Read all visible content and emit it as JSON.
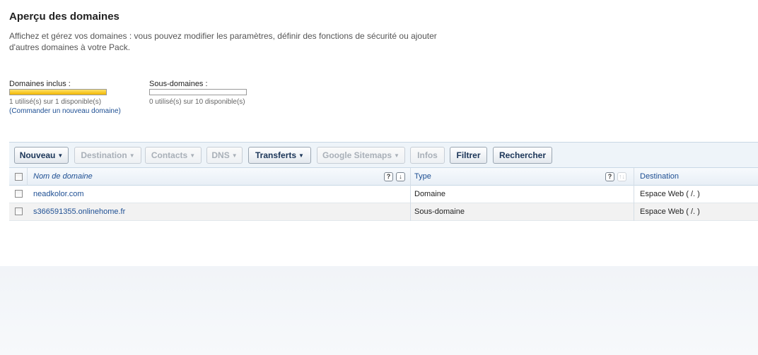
{
  "page": {
    "title": "Aperçu des domaines",
    "intro": "Affichez et gérez vos domaines : vous pouvez modifier les paramètres, définir des fonctions de sécurité ou ajouter d'autres domaines à votre Pack."
  },
  "quotas": {
    "domains": {
      "label": "Domaines inclus :",
      "used": 1,
      "total": 1,
      "fill_fraction": 1.0,
      "usage_text": "1 utilisé(s) sur 1 disponible(s)",
      "order_link": "(Commander un nouveau domaine)",
      "fill_color": "#f2b700"
    },
    "subdomains": {
      "label": "Sous-domaines :",
      "used": 0,
      "total": 10,
      "fill_fraction": 0.0,
      "usage_text": "0 utilisé(s) sur 10 disponible(s)"
    }
  },
  "toolbar": {
    "nouveau": "Nouveau",
    "destination": "Destination",
    "contacts": "Contacts",
    "dns": "DNS",
    "transferts": "Transferts",
    "sitemaps": "Google Sitemaps",
    "infos": "Infos",
    "filtrer": "Filtrer",
    "rechercher": "Rechercher"
  },
  "table": {
    "columns": {
      "name": "Nom de domaine",
      "type": "Type",
      "destination": "Destination"
    },
    "help_glyph": "?",
    "sort_glyph": "↓",
    "sort_glyph_dim": "↑↓",
    "rows": [
      {
        "name": "neadkolor.com",
        "type": "Domaine",
        "destination": "Espace Web ( /. )"
      },
      {
        "name": "s366591355.onlinehome.fr",
        "type": "Sous-domaine",
        "destination": "Espace Web ( /. )"
      }
    ]
  },
  "colors": {
    "link": "#1e4f93",
    "toolbar_bg": "#eef4f9",
    "quota_fill": "#f2b700"
  }
}
